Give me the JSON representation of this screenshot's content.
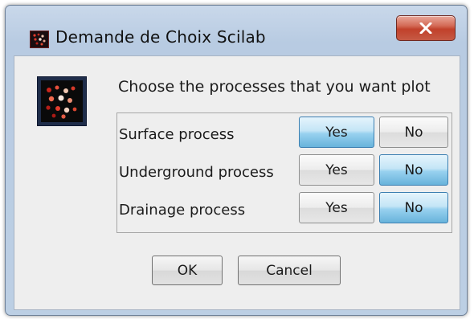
{
  "window": {
    "title": "Demande de Choix Scilab",
    "app_icon": "scilab-icon",
    "close_icon": "close-icon"
  },
  "dialog": {
    "icon": "scilab-dialog-icon",
    "prompt": "Choose the processes that you want plot",
    "rows": [
      {
        "label": "Surface process",
        "yes_label": "Yes",
        "no_label": "No",
        "selected": "Yes"
      },
      {
        "label": "Underground process",
        "yes_label": "Yes",
        "no_label": "No",
        "selected": "No"
      },
      {
        "label": "Drainage process",
        "yes_label": "Yes",
        "no_label": "No",
        "selected": "No"
      }
    ],
    "ok_label": "OK",
    "cancel_label": "Cancel"
  },
  "colors": {
    "selected_button": "#98d1ef",
    "close_button": "#c1412b"
  }
}
